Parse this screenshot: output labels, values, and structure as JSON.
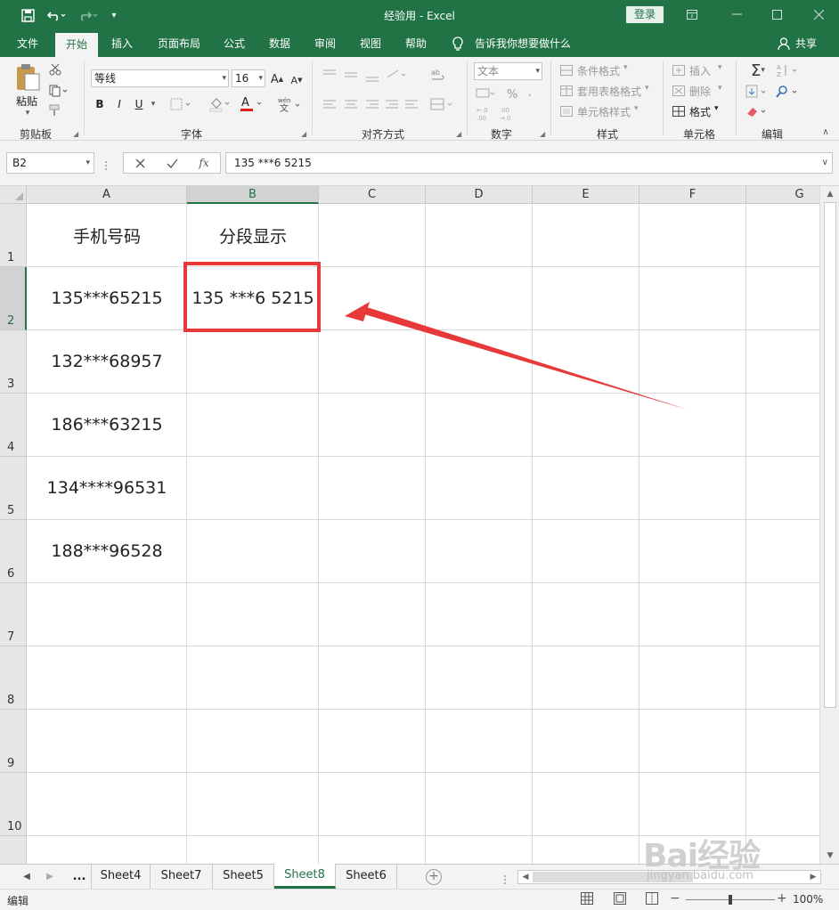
{
  "window": {
    "title": "经验用  -  Excel",
    "login_label": "登录"
  },
  "ribbon_tabs": [
    "文件",
    "开始",
    "插入",
    "页面布局",
    "公式",
    "数据",
    "审阅",
    "视图",
    "帮助"
  ],
  "active_tab": "开始",
  "tell_me": "告诉我你想要做什么",
  "share_label": "共享",
  "ribbon": {
    "clipboard": {
      "paste_label": "粘贴",
      "group_label": "剪贴板"
    },
    "font": {
      "font_name": "等线",
      "font_size": "16",
      "group_label": "字体",
      "bold": "B",
      "italic": "I",
      "underline": "U"
    },
    "alignment": {
      "group_label": "对齐方式"
    },
    "number": {
      "format": "文本",
      "group_label": "数字"
    },
    "styles": {
      "conditional": "条件格式",
      "table": "套用表格格式",
      "cell": "单元格样式",
      "group_label": "样式"
    },
    "cells": {
      "insert": "插入",
      "delete": "删除",
      "format": "格式",
      "group_label": "单元格"
    },
    "editing": {
      "group_label": "编辑"
    }
  },
  "formula_bar": {
    "name_box": "B2",
    "fx": "fx",
    "formula": "135 ***6 5215"
  },
  "columns": [
    "A",
    "B",
    "C",
    "D",
    "E",
    "F",
    "G"
  ],
  "rows": [
    "1",
    "2",
    "3",
    "4",
    "5",
    "6",
    "7",
    "8",
    "9",
    "10"
  ],
  "cells": {
    "A1": "手机号码",
    "B1": "分段显示",
    "A2": "135***65215",
    "B2": "135 ***6 5215",
    "A3": "132***68957",
    "A4": "186***63215",
    "A5": "134****96531",
    "A6": "188***96528"
  },
  "selected_cell": "B2",
  "sheets": [
    "Sheet4",
    "Sheet7",
    "Sheet5",
    "Sheet8",
    "Sheet6"
  ],
  "active_sheet": "Sheet8",
  "sheet_overflow": "...",
  "status": {
    "mode": "编辑",
    "zoom": "100%"
  },
  "watermark": {
    "logo": "Bai经验",
    "url": "jingyan.baidu.com"
  },
  "colors": {
    "accent": "#217346",
    "annotation": "#e8393a"
  }
}
